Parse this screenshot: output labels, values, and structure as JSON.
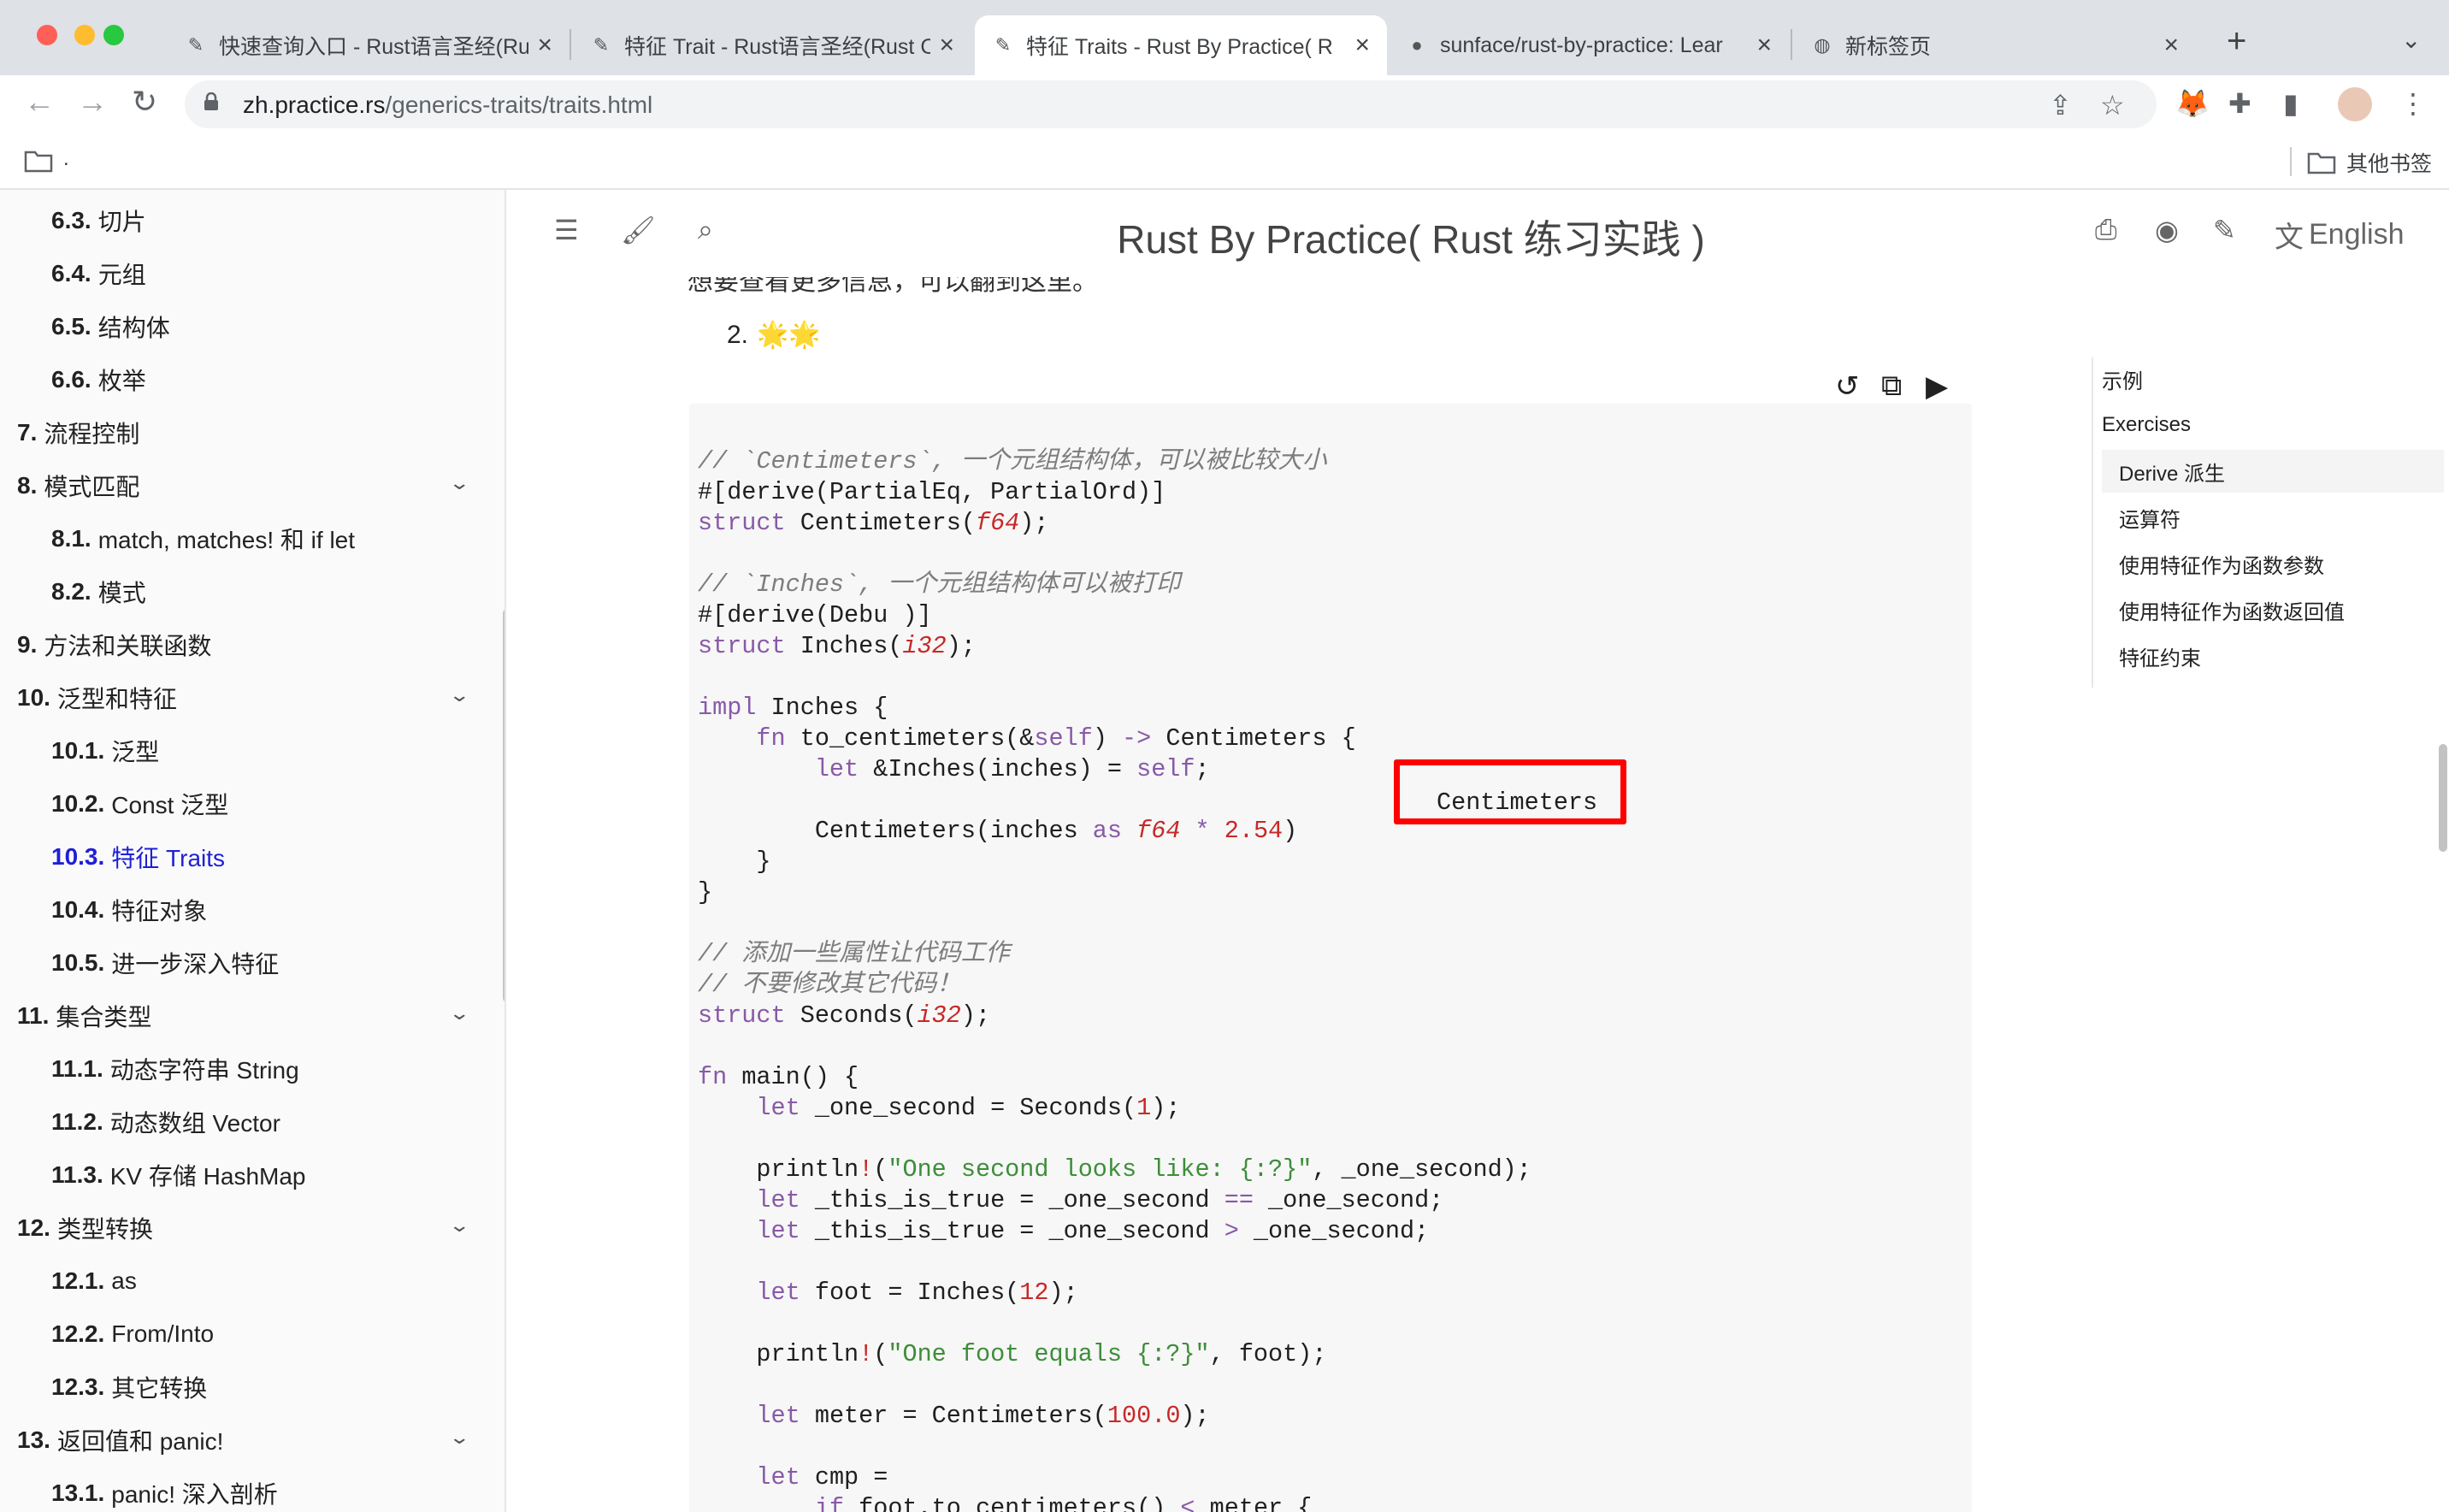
{
  "browser": {
    "tabs": [
      {
        "title": "快速查询入口 - Rust语言圣经(Ru",
        "active": false,
        "icon": "book-icon"
      },
      {
        "title": "特征 Trait - Rust语言圣经(Rust C",
        "active": false,
        "icon": "book-icon"
      },
      {
        "title": "特征 Traits - Rust By Practice( R",
        "active": true,
        "icon": "book-icon"
      },
      {
        "title": "sunface/rust-by-practice: Lear",
        "active": false,
        "icon": "github-icon"
      },
      {
        "title": "新标签页",
        "active": false,
        "icon": "globe-icon"
      }
    ],
    "tab_close": "×",
    "new_tab": "+",
    "tab_menu": "⌄",
    "url_host": "zh.practice.rs",
    "url_path": "/generics-traits/traits.html",
    "bookmarks": {
      "first": ".",
      "other": "其他书签"
    }
  },
  "sidebar": {
    "items": [
      {
        "num": "6.3.",
        "label": "切片",
        "level": 2,
        "fold": false,
        "active": false
      },
      {
        "num": "6.4.",
        "label": "元组",
        "level": 2,
        "fold": false,
        "active": false
      },
      {
        "num": "6.5.",
        "label": "结构体",
        "level": 2,
        "fold": false,
        "active": false
      },
      {
        "num": "6.6.",
        "label": "枚举",
        "level": 2,
        "fold": false,
        "active": false
      },
      {
        "num": "7.",
        "label": "流程控制",
        "level": 1,
        "fold": false,
        "active": false
      },
      {
        "num": "8.",
        "label": "模式匹配",
        "level": 1,
        "fold": true,
        "active": false
      },
      {
        "num": "8.1.",
        "label": "match, matches! 和 if let",
        "level": 2,
        "fold": false,
        "active": false
      },
      {
        "num": "8.2.",
        "label": "模式",
        "level": 2,
        "fold": false,
        "active": false
      },
      {
        "num": "9.",
        "label": "方法和关联函数",
        "level": 1,
        "fold": false,
        "active": false
      },
      {
        "num": "10.",
        "label": "泛型和特征",
        "level": 1,
        "fold": true,
        "active": false
      },
      {
        "num": "10.1.",
        "label": "泛型",
        "level": 2,
        "fold": false,
        "active": false
      },
      {
        "num": "10.2.",
        "label": "Const 泛型",
        "level": 2,
        "fold": false,
        "active": false
      },
      {
        "num": "10.3.",
        "label": "特征 Traits",
        "level": 2,
        "fold": false,
        "active": true
      },
      {
        "num": "10.4.",
        "label": "特征对象",
        "level": 2,
        "fold": false,
        "active": false
      },
      {
        "num": "10.5.",
        "label": "进一步深入特征",
        "level": 2,
        "fold": false,
        "active": false
      },
      {
        "num": "11.",
        "label": "集合类型",
        "level": 1,
        "fold": true,
        "active": false
      },
      {
        "num": "11.1.",
        "label": "动态字符串 String",
        "level": 2,
        "fold": false,
        "active": false
      },
      {
        "num": "11.2.",
        "label": "动态数组 Vector",
        "level": 2,
        "fold": false,
        "active": false
      },
      {
        "num": "11.3.",
        "label": "KV 存储 HashMap",
        "level": 2,
        "fold": false,
        "active": false
      },
      {
        "num": "12.",
        "label": "类型转换",
        "level": 1,
        "fold": true,
        "active": false
      },
      {
        "num": "12.1.",
        "label": "as",
        "level": 2,
        "fold": false,
        "active": false
      },
      {
        "num": "12.2.",
        "label": "From/Into",
        "level": 2,
        "fold": false,
        "active": false
      },
      {
        "num": "12.3.",
        "label": "其它转换",
        "level": 2,
        "fold": false,
        "active": false
      },
      {
        "num": "13.",
        "label": "返回值和 panic!",
        "level": 1,
        "fold": true,
        "active": false
      },
      {
        "num": "13.1.",
        "label": "panic! 深入剖析",
        "level": 2,
        "fold": false,
        "active": false
      }
    ]
  },
  "menubar": {
    "title": "Rust By Practice( Rust 练习实践 )",
    "language": "English"
  },
  "content": {
    "partial_line": "想要查看更多信息，可以翻到这里。",
    "list_number": "2.",
    "stars": "🌟🌟",
    "code": [
      [
        [
          "cm",
          "// `Centimeters`, 一个元组结构体，可以被比较大小"
        ]
      ],
      [
        [
          "",
          "#[derive(PartialEq, PartialOrd)]"
        ]
      ],
      [
        [
          "kw",
          "struct"
        ],
        [
          "",
          " Centimeters("
        ],
        [
          "ty",
          "f64"
        ],
        [
          "",
          ");"
        ]
      ],
      [
        [
          "",
          ""
        ]
      ],
      [
        [
          "cm",
          "// `Inches`, 一个元组结构体可以被打印"
        ]
      ],
      [
        [
          "",
          "#[derive(Debu )]"
        ]
      ],
      [
        [
          "kw",
          "struct"
        ],
        [
          "",
          " Inches("
        ],
        [
          "ty",
          "i32"
        ],
        [
          "",
          ");"
        ]
      ],
      [
        [
          "",
          ""
        ]
      ],
      [
        [
          "kw",
          "impl"
        ],
        [
          "",
          " Inches {"
        ]
      ],
      [
        [
          "",
          "    "
        ],
        [
          "kw",
          "fn"
        ],
        [
          "",
          " to_centimeters(&"
        ],
        [
          "kw",
          "self"
        ],
        [
          "",
          ") "
        ],
        [
          "kw",
          "->"
        ],
        [
          "",
          " Centimeters {"
        ]
      ],
      [
        [
          "",
          "        "
        ],
        [
          "kw",
          "let"
        ],
        [
          "",
          " &Inches(inches) = "
        ],
        [
          "kw",
          "self"
        ],
        [
          "",
          ";"
        ]
      ],
      [
        [
          "",
          ""
        ]
      ],
      [
        [
          "",
          "        Centimeters(inches "
        ],
        [
          "kw",
          "as"
        ],
        [
          "",
          " "
        ],
        [
          "ty",
          "f64"
        ],
        [
          "",
          " "
        ],
        [
          "kw",
          "*"
        ],
        [
          "",
          " "
        ],
        [
          "nm",
          "2.54"
        ],
        [
          "",
          ")"
        ]
      ],
      [
        [
          "",
          "    }"
        ]
      ],
      [
        [
          "",
          "}"
        ]
      ],
      [
        [
          "",
          ""
        ]
      ],
      [
        [
          "cm",
          "// 添加一些属性让代码工作"
        ]
      ],
      [
        [
          "cm",
          "// 不要修改其它代码！"
        ]
      ],
      [
        [
          "kw",
          "struct"
        ],
        [
          "",
          " Seconds("
        ],
        [
          "ty",
          "i32"
        ],
        [
          "",
          ");"
        ]
      ],
      [
        [
          "",
          ""
        ]
      ],
      [
        [
          "kw",
          "fn"
        ],
        [
          "",
          " main() {"
        ]
      ],
      [
        [
          "",
          "    "
        ],
        [
          "kw",
          "let"
        ],
        [
          "",
          " _one_second = Seconds("
        ],
        [
          "nm",
          "1"
        ],
        [
          "",
          ");"
        ]
      ],
      [
        [
          "",
          ""
        ]
      ],
      [
        [
          "",
          "    println"
        ],
        [
          "mc",
          "!"
        ],
        [
          "",
          "("
        ],
        [
          "st",
          "\"One second looks like: {:?}\""
        ],
        [
          "",
          ", _one_second);"
        ]
      ],
      [
        [
          "",
          "    "
        ],
        [
          "kw",
          "let"
        ],
        [
          "",
          " _this_is_true = _one_second "
        ],
        [
          "kw",
          "=="
        ],
        [
          "",
          " _one_second;"
        ]
      ],
      [
        [
          "",
          "    "
        ],
        [
          "kw",
          "let"
        ],
        [
          "",
          " _this_is_true = _one_second "
        ],
        [
          "kw",
          ">"
        ],
        [
          "",
          " _one_second;"
        ]
      ],
      [
        [
          "",
          ""
        ]
      ],
      [
        [
          "",
          "    "
        ],
        [
          "kw",
          "let"
        ],
        [
          "",
          " foot = Inches("
        ],
        [
          "nm",
          "12"
        ],
        [
          "",
          ");"
        ]
      ],
      [
        [
          "",
          ""
        ]
      ],
      [
        [
          "",
          "    println"
        ],
        [
          "mc",
          "!"
        ],
        [
          "",
          "("
        ],
        [
          "st",
          "\"One foot equals {:?}\""
        ],
        [
          "",
          ", foot);"
        ]
      ],
      [
        [
          "",
          ""
        ]
      ],
      [
        [
          "",
          "    "
        ],
        [
          "kw",
          "let"
        ],
        [
          "",
          " meter = Centimeters("
        ],
        [
          "nm",
          "100.0"
        ],
        [
          "",
          ");"
        ]
      ],
      [
        [
          "",
          ""
        ]
      ],
      [
        [
          "",
          "    "
        ],
        [
          "kw",
          "let"
        ],
        [
          "",
          " cmp ="
        ]
      ],
      [
        [
          "",
          "        "
        ],
        [
          "kw",
          "if"
        ],
        [
          "",
          " foot.to_centimeters() "
        ],
        [
          "kw",
          "<"
        ],
        [
          "",
          " meter {"
        ]
      ]
    ],
    "overlay_text": "Centimeters"
  },
  "toc": {
    "items": [
      {
        "label": "示例",
        "sub": false,
        "active": false
      },
      {
        "label": "Exercises",
        "sub": false,
        "active": false
      },
      {
        "label": "Derive 派生",
        "sub": true,
        "active": true
      },
      {
        "label": "运算符",
        "sub": true,
        "active": false
      },
      {
        "label": "使用特征作为函数参数",
        "sub": true,
        "active": false
      },
      {
        "label": "使用特征作为函数返回值",
        "sub": true,
        "active": false
      },
      {
        "label": "特征约束",
        "sub": true,
        "active": false
      }
    ]
  },
  "colors": {
    "highlight_box": "#ff0000",
    "active_link": "#1f1fd6"
  }
}
